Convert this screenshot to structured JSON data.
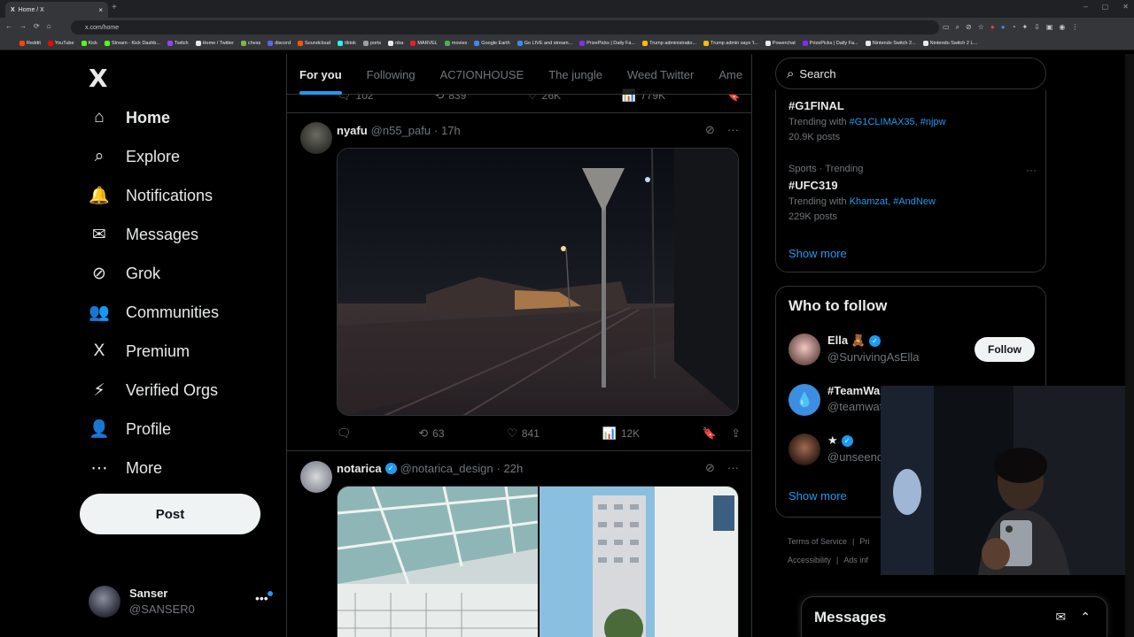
{
  "browser": {
    "tab_title": "Home / X",
    "tab_close": "×",
    "new_tab": "+",
    "url": "x.com/home",
    "nav": [
      "←",
      "→",
      "⟳",
      "⌂"
    ],
    "window_controls": [
      "–",
      "▢",
      "✕"
    ],
    "bookmarks": [
      {
        "label": "Reddit",
        "color": "#ff4500"
      },
      {
        "label": "YouTube",
        "color": "#ff0000"
      },
      {
        "label": "Kick",
        "color": "#53fc18"
      },
      {
        "label": "Stream - Kick Dashb...",
        "color": "#53fc18"
      },
      {
        "label": "Twitch",
        "color": "#9146ff"
      },
      {
        "label": "Home / Twitter",
        "color": "#e7e9ea"
      },
      {
        "label": "chess",
        "color": "#81b64c"
      },
      {
        "label": "discord",
        "color": "#5865f2"
      },
      {
        "label": "Soundcloud",
        "color": "#ff5500"
      },
      {
        "label": "tiktok",
        "color": "#25f4ee"
      },
      {
        "label": "ports",
        "color": "#9aa0a6"
      },
      {
        "label": "nba",
        "color": "#e7e9ea"
      },
      {
        "label": "MARVEL",
        "color": "#ec1d24"
      },
      {
        "label": "movies",
        "color": "#4caf50"
      },
      {
        "label": "Google Earth",
        "color": "#4285f4"
      },
      {
        "label": "Go LIVE and stream...",
        "color": "#4285f4"
      },
      {
        "label": "PrizePicks | Daily Fa...",
        "color": "#7b2ff7"
      },
      {
        "label": "Trump administratio...",
        "color": "#fbbc04"
      },
      {
        "label": "Trump admin says 't...",
        "color": "#fbbc04"
      },
      {
        "label": "Powerchat",
        "color": "#e7e9ea"
      },
      {
        "label": "PrizePicks | Daily Fa...",
        "color": "#7b2ff7"
      },
      {
        "label": "Nintendo Switch 2...",
        "color": "#e7e9ea"
      },
      {
        "label": "Nintendo Switch 2 L...",
        "color": "#e7e9ea"
      }
    ]
  },
  "sidebar": {
    "logo": "X",
    "items": [
      {
        "label": "Home",
        "icon": "⌂"
      },
      {
        "label": "Explore",
        "icon": "⌕"
      },
      {
        "label": "Notifications",
        "icon": "🔔"
      },
      {
        "label": "Messages",
        "icon": "✉"
      },
      {
        "label": "Grok",
        "icon": "⊘"
      },
      {
        "label": "Communities",
        "icon": "👥"
      },
      {
        "label": "Premium",
        "icon": "X"
      },
      {
        "label": "Verified Orgs",
        "icon": "⚡"
      },
      {
        "label": "Profile",
        "icon": "👤"
      },
      {
        "label": "More",
        "icon": "⋯"
      }
    ],
    "post_label": "Post",
    "account": {
      "name": "Sanser",
      "handle": "@SANSER0",
      "more": "•••"
    }
  },
  "feed": {
    "tabs": [
      "For you",
      "Following",
      "AC7IONHOUSE",
      "The jungle",
      "Weed Twitter",
      "Ame"
    ],
    "top_actions": {
      "replies": "102",
      "reposts": "839",
      "likes": "26K",
      "views": "779K"
    },
    "tweets": [
      {
        "name": "nyafu",
        "handle": "@n55_pafu",
        "time": "· 17h",
        "replies": "",
        "reposts": "63",
        "likes": "841",
        "views": "12K"
      },
      {
        "name": "notarica",
        "handle": "@notarica_design",
        "time": "· 22h"
      }
    ],
    "icons": {
      "reply": "🗨",
      "repost": "⟲",
      "like": "♡",
      "views": "📊",
      "bookmark": "🔖",
      "share": "⇪",
      "grok": "⊘",
      "more": "···"
    }
  },
  "right": {
    "search_placeholder": "Search",
    "trends": [
      {
        "meta": "",
        "title": "#G1FINAL",
        "with_prefix": "Trending with",
        "with": "#G1CLIMAX35, #njpw",
        "posts": "20.9K posts"
      },
      {
        "meta": "Sports · Trending",
        "title": "#UFC319",
        "with_prefix": "Trending with",
        "with": "Khamzat, #AndNew",
        "posts": "229K posts"
      }
    ],
    "trends_show_more": "Show more",
    "who_to_follow": {
      "title": "Who to follow",
      "users": [
        {
          "name": "Ella 🧸",
          "handle": "@SurvivingAsElla"
        },
        {
          "name": "#TeamWa",
          "handle": "@teamwat"
        },
        {
          "name": "★",
          "handle": "@unseeno"
        }
      ],
      "follow_label": "Follow",
      "show_more": "Show more"
    },
    "footer": [
      "Terms of Service",
      "|",
      "Pri",
      "Accessibility",
      "|",
      "Ads inf"
    ],
    "messages": {
      "title": "Messages",
      "compose_icon": "✉",
      "expand_icon": "⌃"
    }
  }
}
